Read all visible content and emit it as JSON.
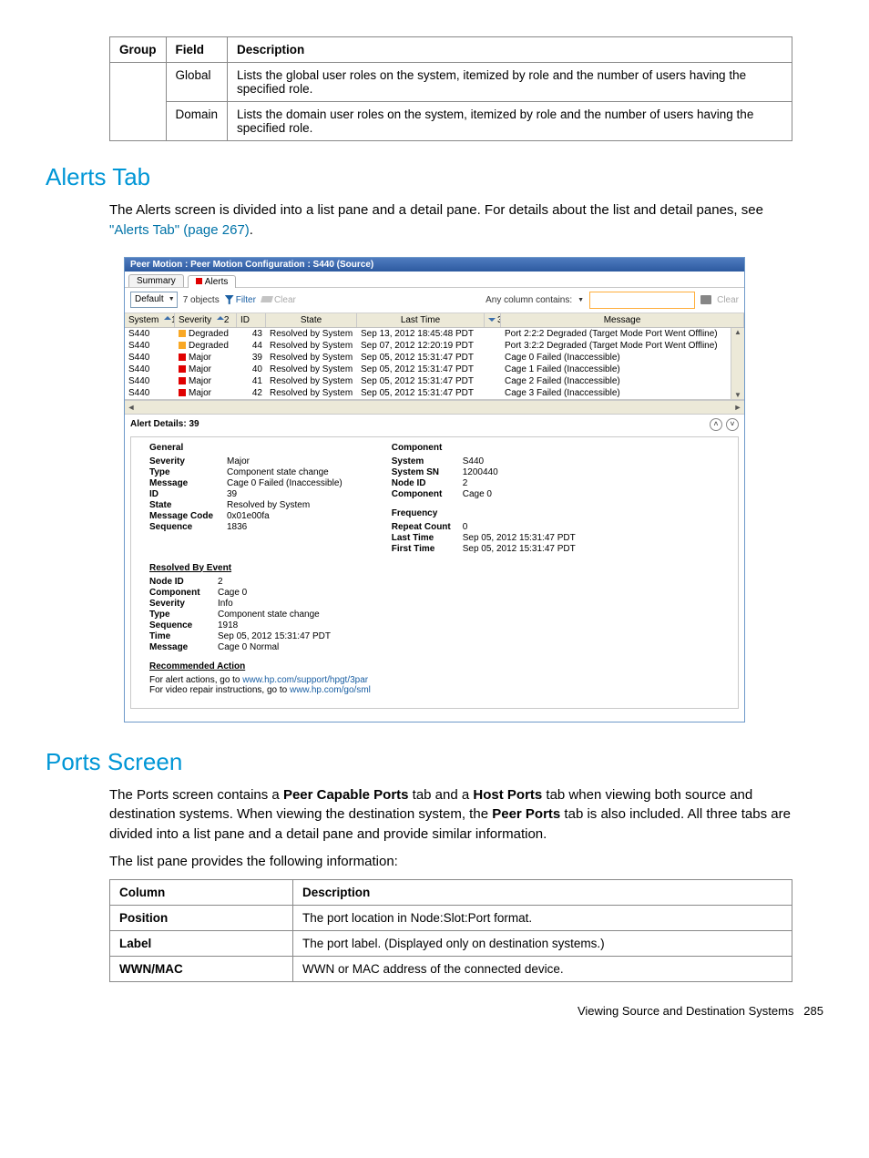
{
  "topTable": {
    "headers": [
      "Group",
      "Field",
      "Description"
    ],
    "rows": [
      [
        "",
        "Global",
        "Lists the global user roles on the system, itemized by role and the number of users having the specified role."
      ],
      [
        "",
        "Domain",
        "Lists the domain user roles on the system, itemized by role and the number of users having the specified role."
      ]
    ]
  },
  "alertsHeading": "Alerts Tab",
  "alertsIntro_a": "The Alerts screen is divided into a list pane and a detail pane. For details about the list and detail panes, see ",
  "alertsIntro_link": "\"Alerts Tab\" (page 267)",
  "alertsIntro_b": ".",
  "app": {
    "title": "Peer Motion : Peer Motion Configuration : S440 (Source)",
    "tabs": {
      "summary": "Summary",
      "alerts": "Alerts"
    },
    "toolbar": {
      "combo": "Default",
      "count": "7 objects",
      "filter": "Filter",
      "clear": "Clear",
      "anycol": "Any column contains:",
      "clearBtn": "Clear"
    },
    "columns": {
      "system": "System",
      "system_n": "1",
      "severity": "Severity",
      "severity_n": "2",
      "id": "ID",
      "state": "State",
      "lasttime": "Last Time",
      "sort3": "3",
      "message": "Message"
    },
    "rows": [
      {
        "sys": "S440",
        "sev": "Degraded",
        "sevClass": "sev-deg",
        "id": "43",
        "state": "Resolved by System",
        "time": "Sep 13, 2012 18:45:48 PDT",
        "msg": "Port 2:2:2 Degraded (Target Mode Port Went Offline)"
      },
      {
        "sys": "S440",
        "sev": "Degraded",
        "sevClass": "sev-deg",
        "id": "44",
        "state": "Resolved by System",
        "time": "Sep 07, 2012 12:20:19 PDT",
        "msg": "Port 3:2:2 Degraded (Target Mode Port Went Offline)"
      },
      {
        "sys": "S440",
        "sev": "Major",
        "sevClass": "sev-maj",
        "id": "39",
        "state": "Resolved by System",
        "time": "Sep 05, 2012 15:31:47 PDT",
        "msg": "Cage 0 Failed (Inaccessible)"
      },
      {
        "sys": "S440",
        "sev": "Major",
        "sevClass": "sev-maj",
        "id": "40",
        "state": "Resolved by System",
        "time": "Sep 05, 2012 15:31:47 PDT",
        "msg": "Cage 1 Failed (Inaccessible)"
      },
      {
        "sys": "S440",
        "sev": "Major",
        "sevClass": "sev-maj",
        "id": "41",
        "state": "Resolved by System",
        "time": "Sep 05, 2012 15:31:47 PDT",
        "msg": "Cage 2 Failed (Inaccessible)"
      },
      {
        "sys": "S440",
        "sev": "Major",
        "sevClass": "sev-maj",
        "id": "42",
        "state": "Resolved by System",
        "time": "Sep 05, 2012 15:31:47 PDT",
        "msg": "Cage 3 Failed (Inaccessible)"
      }
    ],
    "detailsTitle": "Alert Details: 39",
    "general": {
      "heading": "General",
      "Severity": "Major",
      "Type": "Component state change",
      "Message": "Cage 0 Failed (Inaccessible)",
      "ID": "39",
      "State": "Resolved by System",
      "MessageCode": "0x01e00fa",
      "Sequence": "1836"
    },
    "component": {
      "heading": "Component",
      "System": "S440",
      "SystemSN": "1200440",
      "NodeID": "2",
      "Component": "Cage 0"
    },
    "frequency": {
      "heading": "Frequency",
      "RepeatCount": "0",
      "LastTime": "Sep 05, 2012 15:31:47 PDT",
      "FirstTime": "Sep 05, 2012 15:31:47 PDT"
    },
    "resolved": {
      "heading": "Resolved By Event",
      "NodeID": "2",
      "Component": "Cage 0",
      "Severity": "Info",
      "Type": "Component state change",
      "Sequence": "1918",
      "Time": "Sep 05, 2012 15:31:47 PDT",
      "Message": "Cage 0 Normal"
    },
    "recommended": {
      "heading": "Recommended Action",
      "line1a": "For alert actions, go to ",
      "line1b": "www.hp.com/support/hpgt/3par",
      "line2a": "For video repair instructions, go to ",
      "line2b": "www.hp.com/go/sml"
    }
  },
  "portsHeading": "Ports Screen",
  "portsPara1_a": "The Ports screen contains a ",
  "portsPara1_b": "Peer Capable Ports",
  "portsPara1_c": " tab and a ",
  "portsPara1_d": "Host Ports",
  "portsPara1_e": " tab when viewing both source and destination systems. When viewing the destination system, the ",
  "portsPara1_f": "Peer Ports",
  "portsPara1_g": " tab is also included. All three tabs are divided into a list pane and a detail pane and provide similar information.",
  "portsPara2": "The list pane provides the following information:",
  "portsTable": {
    "headers": [
      "Column",
      "Description"
    ],
    "rows": [
      [
        "Position",
        "The port location in Node:Slot:Port format."
      ],
      [
        "Label",
        "The port label. (Displayed only on destination systems.)"
      ],
      [
        "WWN/MAC",
        "WWN or MAC address of the connected device."
      ]
    ]
  },
  "footer": {
    "text": "Viewing Source and Destination Systems",
    "page": "285"
  }
}
